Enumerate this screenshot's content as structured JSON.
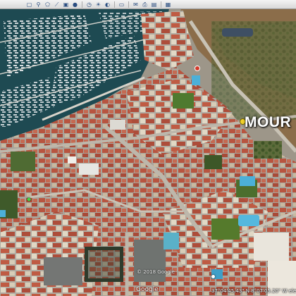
{
  "map": {
    "place_label": "MOUR",
    "copyright": "© 2018 Google",
    "status": "37°04'45.43\" N  8°07'05.20\" W  elev",
    "google_logo": "Google",
    "colors": {
      "water": "#1e4a52",
      "roof": "#b8543f",
      "road": "#a9a49b",
      "vegetation": "#4f6b33",
      "dry_land": "#8b6d4a",
      "pool": "#4cb0d8",
      "label": "#ffffff",
      "pin": "#f1d22a"
    }
  },
  "toolbar": {
    "buttons": [
      {
        "name": "sidebar-toggle",
        "icon": "▢"
      },
      {
        "name": "placemark",
        "icon": "⚲"
      },
      {
        "name": "polygon",
        "icon": "⬠"
      },
      {
        "name": "path",
        "icon": "⟋"
      },
      {
        "name": "image-overlay",
        "icon": "▣"
      },
      {
        "name": "record-tour",
        "icon": "●"
      },
      {
        "name": "historical-imagery",
        "icon": "◷"
      },
      {
        "name": "sun",
        "icon": "☀"
      },
      {
        "name": "planets",
        "icon": "◐"
      },
      {
        "name": "ruler",
        "icon": "▭"
      },
      {
        "name": "email",
        "icon": "✉"
      },
      {
        "name": "print",
        "icon": "⎙"
      },
      {
        "name": "save-image",
        "icon": "▤"
      },
      {
        "name": "maps",
        "icon": "▦"
      }
    ]
  }
}
